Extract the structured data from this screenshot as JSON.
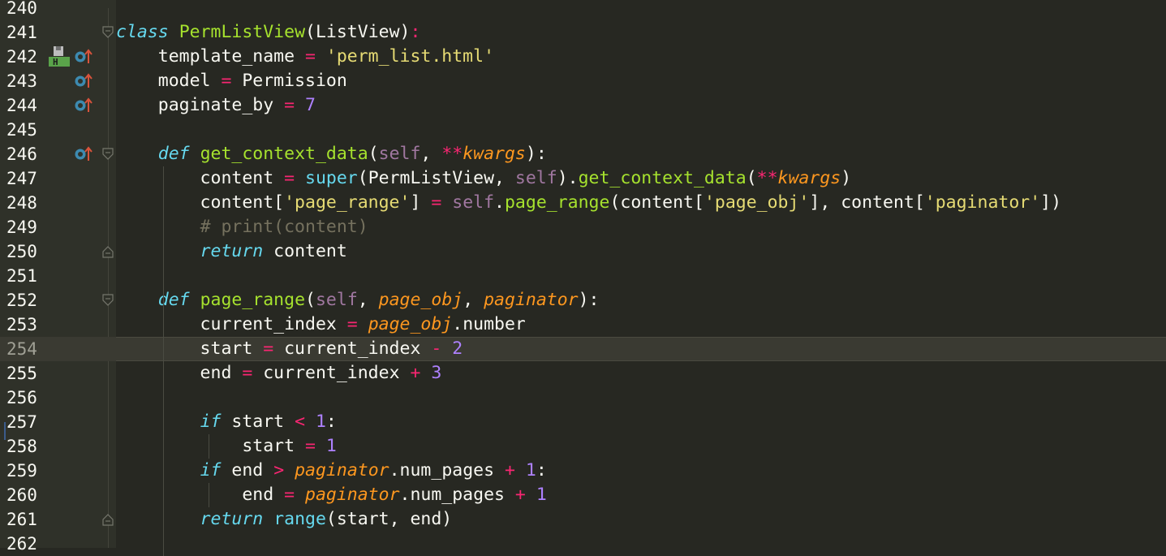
{
  "editor": {
    "current_line": "254",
    "gutter_icons": {
      "bookmark": "floppy-h-icon",
      "bookmark_letter": "H",
      "override": "override-up-arrow-icon"
    },
    "lines": [
      {
        "n": "240",
        "tokens": []
      },
      {
        "n": "241",
        "tokens": [
          [
            "kw",
            "class"
          ],
          [
            "",
            " "
          ],
          [
            "cls",
            "PermListView"
          ],
          [
            "",
            "(ListView)"
          ],
          [
            "op",
            ":"
          ]
        ]
      },
      {
        "n": "242",
        "tokens": [
          [
            "",
            "    template_name "
          ],
          [
            "op",
            "="
          ],
          [
            "",
            " "
          ],
          [
            "str",
            "'perm_list.html'"
          ]
        ]
      },
      {
        "n": "243",
        "tokens": [
          [
            "",
            "    model "
          ],
          [
            "op",
            "="
          ],
          [
            "",
            " Permission"
          ]
        ]
      },
      {
        "n": "244",
        "tokens": [
          [
            "",
            "    paginate_by "
          ],
          [
            "op",
            "="
          ],
          [
            "",
            " "
          ],
          [
            "num",
            "7"
          ]
        ]
      },
      {
        "n": "245",
        "tokens": []
      },
      {
        "n": "246",
        "tokens": [
          [
            "",
            "    "
          ],
          [
            "kw",
            "def"
          ],
          [
            "",
            " "
          ],
          [
            "fn",
            "get_context_data"
          ],
          [
            "",
            "("
          ],
          [
            "self",
            "self"
          ],
          [
            "",
            ", "
          ],
          [
            "op",
            "**"
          ],
          [
            "param",
            "kwargs"
          ],
          [
            "",
            "):"
          ]
        ]
      },
      {
        "n": "247",
        "tokens": [
          [
            "",
            "        content "
          ],
          [
            "op",
            "="
          ],
          [
            "",
            " "
          ],
          [
            "builtin",
            "super"
          ],
          [
            "",
            "(PermListView, "
          ],
          [
            "self",
            "self"
          ],
          [
            "",
            "). "
          ],
          [
            "fn",
            "get_context_data"
          ],
          [
            "",
            "("
          ],
          [
            "op",
            "**"
          ],
          [
            "param",
            "kwargs"
          ],
          [
            "",
            ")"
          ]
        ]
      },
      {
        "n": "248",
        "tokens": [
          [
            "",
            "        content["
          ],
          [
            "str",
            "'page_range'"
          ],
          [
            "",
            "] "
          ],
          [
            "op",
            "="
          ],
          [
            "",
            " "
          ],
          [
            "self",
            "self"
          ],
          [
            "",
            "."
          ],
          [
            "fn",
            "page_range"
          ],
          [
            "",
            "(content["
          ],
          [
            "str",
            "'page_obj'"
          ],
          [
            "",
            "], content["
          ],
          [
            "str",
            "'paginator'"
          ],
          [
            "",
            "])"
          ]
        ]
      },
      {
        "n": "249",
        "tokens": [
          [
            "",
            "        "
          ],
          [
            "cmt",
            "# print(content)"
          ]
        ]
      },
      {
        "n": "250",
        "tokens": [
          [
            "",
            "        "
          ],
          [
            "kw",
            "return"
          ],
          [
            "",
            " content"
          ]
        ]
      },
      {
        "n": "251",
        "tokens": []
      },
      {
        "n": "252",
        "tokens": [
          [
            "",
            "    "
          ],
          [
            "kw",
            "def"
          ],
          [
            "",
            " "
          ],
          [
            "fn",
            "page_range"
          ],
          [
            "",
            "("
          ],
          [
            "self",
            "self"
          ],
          [
            "",
            ", "
          ],
          [
            "param",
            "page_obj"
          ],
          [
            "",
            ", "
          ],
          [
            "param",
            "paginator"
          ],
          [
            "",
            "):"
          ]
        ]
      },
      {
        "n": "253",
        "tokens": [
          [
            "",
            "        current_index "
          ],
          [
            "op",
            "="
          ],
          [
            "",
            " "
          ],
          [
            "param",
            "page_obj"
          ],
          [
            "",
            ".number"
          ]
        ]
      },
      {
        "n": "254",
        "tokens": [
          [
            "",
            "        start "
          ],
          [
            "op",
            "="
          ],
          [
            "",
            " current_index "
          ],
          [
            "op",
            "-"
          ],
          [
            "",
            " "
          ],
          [
            "num",
            "2"
          ]
        ]
      },
      {
        "n": "255",
        "tokens": [
          [
            "",
            "        end "
          ],
          [
            "op",
            "="
          ],
          [
            "",
            " current_index "
          ],
          [
            "op",
            "+"
          ],
          [
            "",
            " "
          ],
          [
            "num",
            "3"
          ]
        ]
      },
      {
        "n": "256",
        "tokens": []
      },
      {
        "n": "257",
        "tokens": [
          [
            "",
            "        "
          ],
          [
            "kw",
            "if"
          ],
          [
            "",
            " start "
          ],
          [
            "op",
            "<"
          ],
          [
            "",
            " "
          ],
          [
            "num",
            "1"
          ],
          [
            "",
            ":"
          ]
        ]
      },
      {
        "n": "258",
        "tokens": [
          [
            "",
            "            start "
          ],
          [
            "op",
            "="
          ],
          [
            "",
            " "
          ],
          [
            "num",
            "1"
          ]
        ]
      },
      {
        "n": "259",
        "tokens": [
          [
            "",
            "        "
          ],
          [
            "kw",
            "if"
          ],
          [
            "",
            " end "
          ],
          [
            "op",
            ">"
          ],
          [
            "",
            " "
          ],
          [
            "param",
            "paginator"
          ],
          [
            "",
            ".num_pages "
          ],
          [
            "op",
            "+"
          ],
          [
            "",
            " "
          ],
          [
            "num",
            "1"
          ],
          [
            "",
            ":"
          ]
        ]
      },
      {
        "n": "260",
        "tokens": [
          [
            "",
            "            end "
          ],
          [
            "op",
            "="
          ],
          [
            "",
            " "
          ],
          [
            "param",
            "paginator"
          ],
          [
            "",
            ".num_pages "
          ],
          [
            "op",
            "+"
          ],
          [
            "",
            " "
          ],
          [
            "num",
            "1"
          ]
        ]
      },
      {
        "n": "261",
        "tokens": [
          [
            "",
            "        "
          ],
          [
            "kw",
            "return"
          ],
          [
            "",
            " "
          ],
          [
            "builtin",
            "range"
          ],
          [
            "",
            "(start, end)"
          ]
        ]
      },
      {
        "n": "262",
        "tokens": []
      }
    ]
  }
}
